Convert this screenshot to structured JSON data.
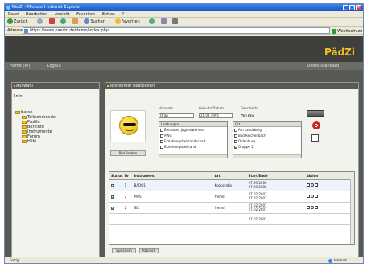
{
  "window": {
    "title": "PädZi - Microsoft Internet Explorer"
  },
  "menu": [
    "Datei",
    "Bearbeiten",
    "Ansicht",
    "Favoriten",
    "Extras",
    "?"
  ],
  "toolbar": {
    "back": "Zurück",
    "search": "Suchen",
    "favorites": "Favoriten"
  },
  "address": {
    "label": "Adresse",
    "url": "https://www.paedzi.de/demo/index.php",
    "go": "Wechseln zu"
  },
  "brand": "PädZi",
  "nav": {
    "left": [
      "Home (W)",
      "Logout"
    ],
    "right": "Demo-Standard"
  },
  "left_panel": {
    "title": "Auswahl",
    "info": "Info",
    "tree": [
      {
        "label": "Kasse",
        "level": 0
      },
      {
        "label": "Teilnehmende",
        "level": 1
      },
      {
        "label": "Profile",
        "level": 1
      },
      {
        "label": "Berichte",
        "level": 1
      },
      {
        "label": "Instrumente",
        "level": 1
      },
      {
        "label": "Forum",
        "level": 1
      },
      {
        "label": "Hilfe",
        "level": 1
      }
    ]
  },
  "main_panel": {
    "title": "Teilnehmer bearbeiten",
    "fields": {
      "vorname_label": "Vorname",
      "vorname_value": "Oran",
      "birth_label": "Geburts-Datum",
      "birth_value": "21.03.1995",
      "gender_label": "Geschlecht",
      "gender_m": "m",
      "gender_w": "w"
    },
    "edit_button": "Bild ändern",
    "lists": [
      {
        "title": "Leistungen",
        "items": [
          {
            "label": "Betreutes Jugendwohnen",
            "checked": false
          },
          {
            "label": "AWG",
            "checked": false
          },
          {
            "label": "Erziehungsbeistandschaft",
            "checked": false
          },
          {
            "label": "Erziehungsbeistand",
            "checked": false
          }
        ]
      },
      {
        "title": "Ort",
        "items": [
          {
            "label": "Am Landsberg",
            "checked": false
          },
          {
            "label": "Bad Reichenbach",
            "checked": false
          },
          {
            "label": "Oldenburg",
            "checked": false
          },
          {
            "label": "Gruppe 1",
            "checked": true
          }
        ]
      }
    ],
    "table": {
      "headers": [
        "Status",
        "Nr",
        "Instrument",
        "Art",
        "Start/Ende",
        "Aktion"
      ],
      "rows": [
        {
          "nr": "1",
          "instrument": "BADO1",
          "art": "Kooperativ",
          "start": "27.09.2006",
          "end": "27.09.2006"
        },
        {
          "nr": "2",
          "instrument": "PWS",
          "art": "fremd",
          "start": "27.02.2007",
          "end": "27.02.2007"
        },
        {
          "nr": "2",
          "instrument": "SIK",
          "art": "fremd",
          "start": "27.02.2007",
          "end": "27.02.2007"
        },
        {
          "nr": "",
          "instrument": "",
          "art": "",
          "start": "27.02.2007",
          "end": ""
        }
      ]
    },
    "save_button": "Speichern",
    "cancel_button": "Abbruch"
  },
  "status": {
    "left": "Fertig",
    "right": "Internet"
  }
}
